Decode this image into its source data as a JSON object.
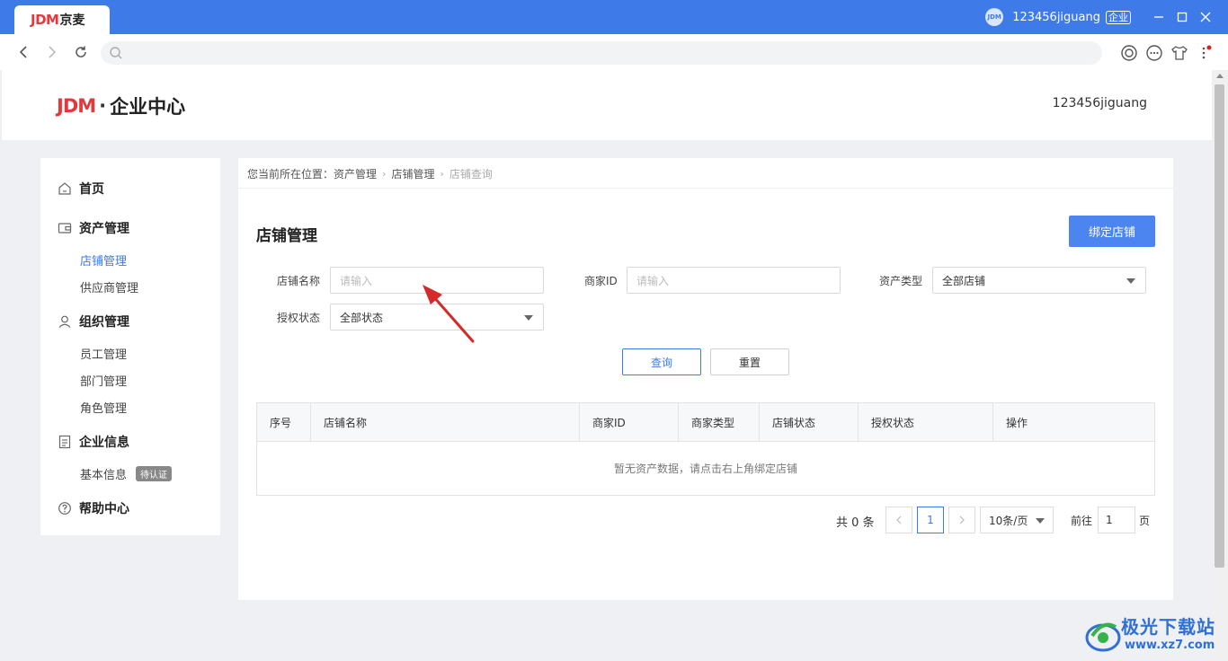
{
  "browser": {
    "tab_logo": "JDM",
    "tab_title": "京麦",
    "avatar_text": "JDM",
    "user": "123456jiguang",
    "user_badge": "企业"
  },
  "header": {
    "brand_logo": "JDM",
    "brand_title": "企业中心",
    "username": "123456jiguang"
  },
  "sidebar": {
    "home": "首页",
    "assets": "资产管理",
    "assets_items": [
      "店铺管理",
      "供应商管理"
    ],
    "org": "组织管理",
    "org_items": [
      "员工管理",
      "部门管理",
      "角色管理"
    ],
    "info": "企业信息",
    "info_item": "基本信息",
    "info_tag": "待认证",
    "help": "帮助中心"
  },
  "breadcrumb": {
    "prefix": "您当前所在位置：",
    "items": [
      "资产管理",
      "店铺管理",
      "店铺查询"
    ]
  },
  "page": {
    "title": "店铺管理",
    "bind_button": "绑定店铺"
  },
  "filters": {
    "shop_name_label": "店铺名称",
    "shop_name_placeholder": "请输入",
    "merchant_id_label": "商家ID",
    "merchant_id_placeholder": "请输入",
    "asset_type_label": "资产类型",
    "asset_type_value": "全部店铺",
    "auth_status_label": "授权状态",
    "auth_status_value": "全部状态",
    "query_button": "查询",
    "reset_button": "重置"
  },
  "table": {
    "columns": [
      "序号",
      "店铺名称",
      "商家ID",
      "商家类型",
      "店铺状态",
      "授权状态",
      "操作"
    ],
    "empty_text": "暂无资产数据，请点击右上角绑定店铺"
  },
  "pagination": {
    "total": "共 0 条",
    "current_page": "1",
    "page_size": "10条/页",
    "goto_label": "前往",
    "goto_value": "1",
    "page_suffix": "页"
  },
  "watermark": {
    "name": "极光下载站",
    "url": "www.xz7.com"
  },
  "colors": {
    "accent": "#3f7be8",
    "primary_button": "#4c84f0",
    "annotation_arrow": "#d42a2a",
    "brand_red": "#e4393c"
  }
}
